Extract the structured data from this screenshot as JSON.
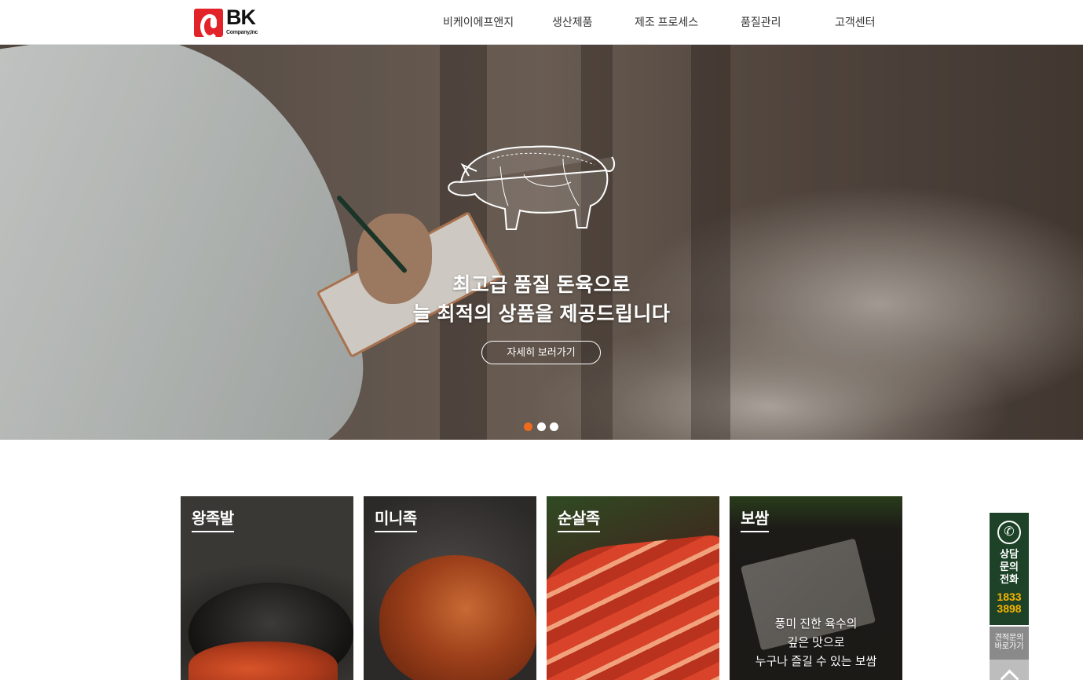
{
  "brand": {
    "logo_text": "BK",
    "logo_sub": "Company,Inc",
    "accent": "#e2232a"
  },
  "nav": {
    "items": [
      {
        "label": "비케이에프앤지"
      },
      {
        "label": "생산제품"
      },
      {
        "label": "제조 프로세스"
      },
      {
        "label": "품질관리"
      },
      {
        "label": "고객센터"
      }
    ]
  },
  "hero": {
    "line1": "최고급 품질 돈육으로",
    "line2": "늘 최적의 상품을 제공드립니다",
    "button_label": "자세히 보러가기",
    "slides_total": 3,
    "slide_active": 1,
    "dot_active_color": "#ef6a1f"
  },
  "products": [
    {
      "title": "왕족발",
      "desc": []
    },
    {
      "title": "미니족",
      "desc": []
    },
    {
      "title": "순살족",
      "desc": []
    },
    {
      "title": "보쌈",
      "desc": [
        "풍미 진한 육수의",
        "깊은 맛으로",
        "누구나 즐길 수 있는 보쌈"
      ]
    }
  ],
  "side": {
    "call_label": [
      "상담",
      "문의",
      "전화"
    ],
    "phone": [
      "1833",
      "3898"
    ],
    "quote_label": [
      "견적문의",
      "바로가기"
    ],
    "icons": {
      "call": "phone-icon",
      "top": "chevron-up-icon"
    },
    "colors": {
      "call_bg": "#1d4227",
      "phone": "#f7b500"
    }
  }
}
